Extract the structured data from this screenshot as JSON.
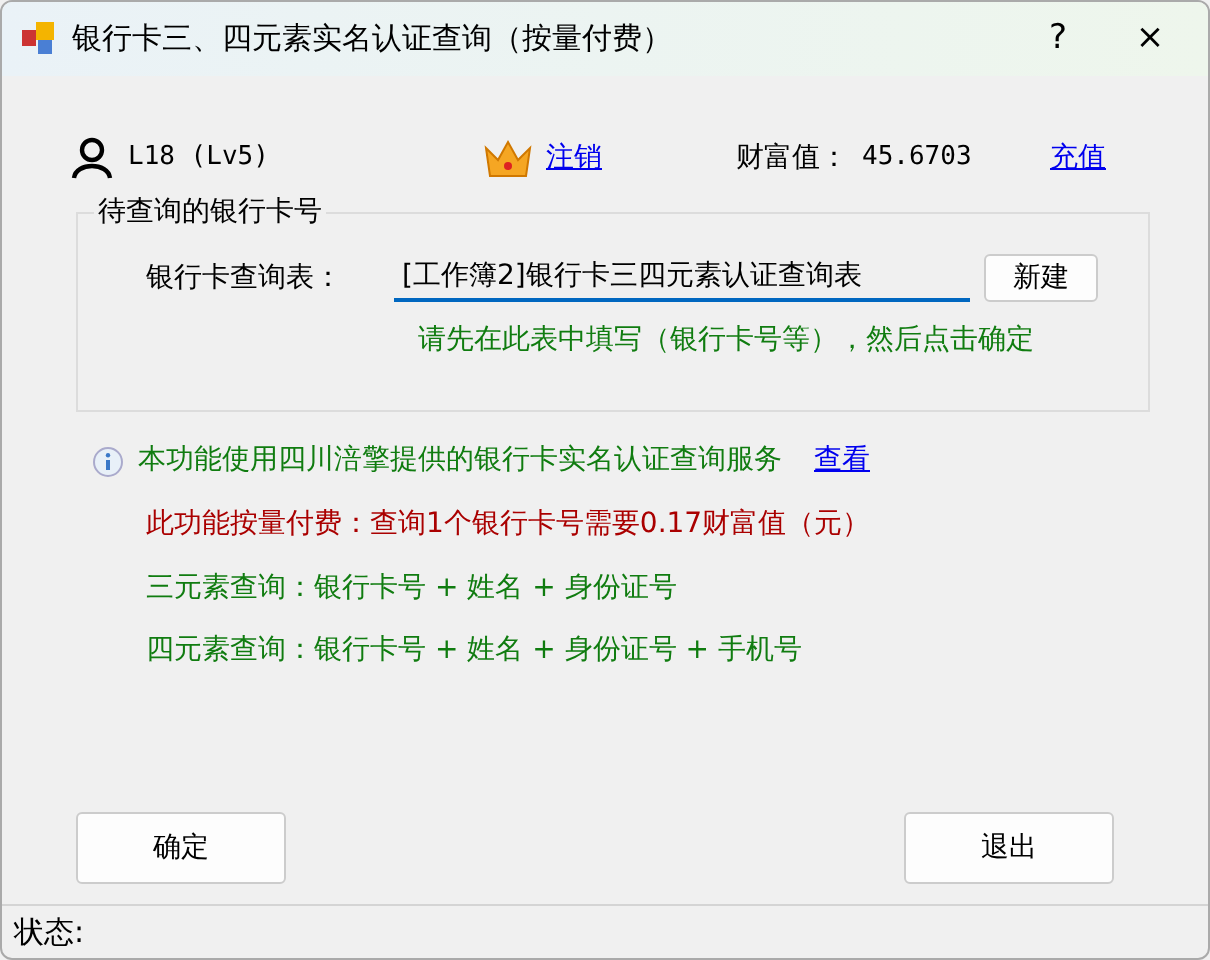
{
  "window": {
    "title": "银行卡三、四元素实名认证查询（按量付费）",
    "help": "?",
    "close": "×"
  },
  "user": {
    "name": "L18 (Lv5)",
    "logout": "注销",
    "wealth_label": "财富值：",
    "wealth": "45.6703",
    "recharge": "充值"
  },
  "group": {
    "title": "待查询的银行卡号",
    "field_label": "银行卡查询表：",
    "field_value": "[工作簿2]银行卡三四元素认证查询表",
    "new_button": "新建",
    "hint": "请先在此表中填写（银行卡号等），然后点击确定"
  },
  "info": {
    "service": "本功能使用四川涪擎提供的银行卡实名认证查询服务",
    "view_link": "查看",
    "fee": "此功能按量付费：查询1个银行卡号需要0.17财富值（元）",
    "lines": [
      "三元素查询：银行卡号 + 姓名 + 身份证号",
      "四元素查询：银行卡号 + 姓名 + 身份证号 + 手机号"
    ]
  },
  "buttons": {
    "ok": "确定",
    "exit": "退出"
  },
  "status_bar": {
    "label": "状态:"
  }
}
